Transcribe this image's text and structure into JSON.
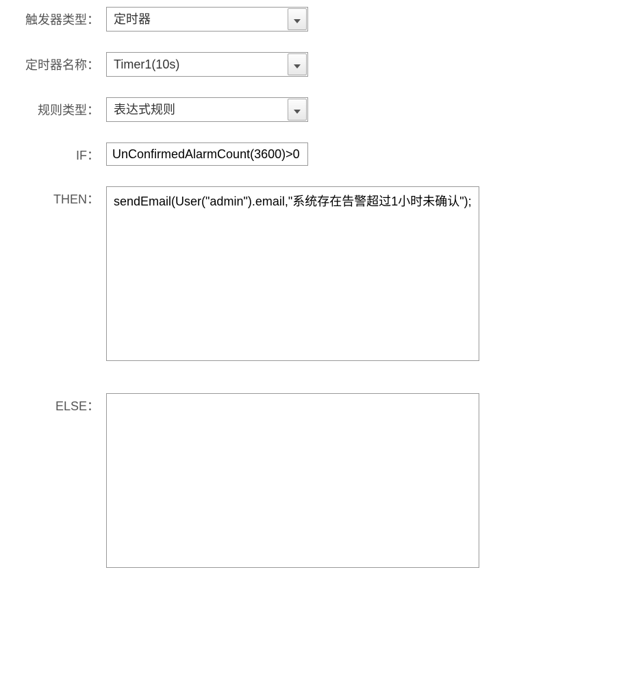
{
  "form": {
    "trigger_type": {
      "label": "触发器类型：",
      "value": "定时器"
    },
    "timer_name": {
      "label": "定时器名称：",
      "value": "Timer1(10s)"
    },
    "rule_type": {
      "label": "规则类型：",
      "value": "表达式规则"
    },
    "if_field": {
      "label": "IF：",
      "value": "UnConfirmedAlarmCount(3600)>0"
    },
    "then_field": {
      "label": "THEN：",
      "value": "sendEmail(User(\"admin\").email,\"系统存在告警超过1小时未确认\");"
    },
    "else_field": {
      "label": "ELSE：",
      "value": ""
    }
  }
}
